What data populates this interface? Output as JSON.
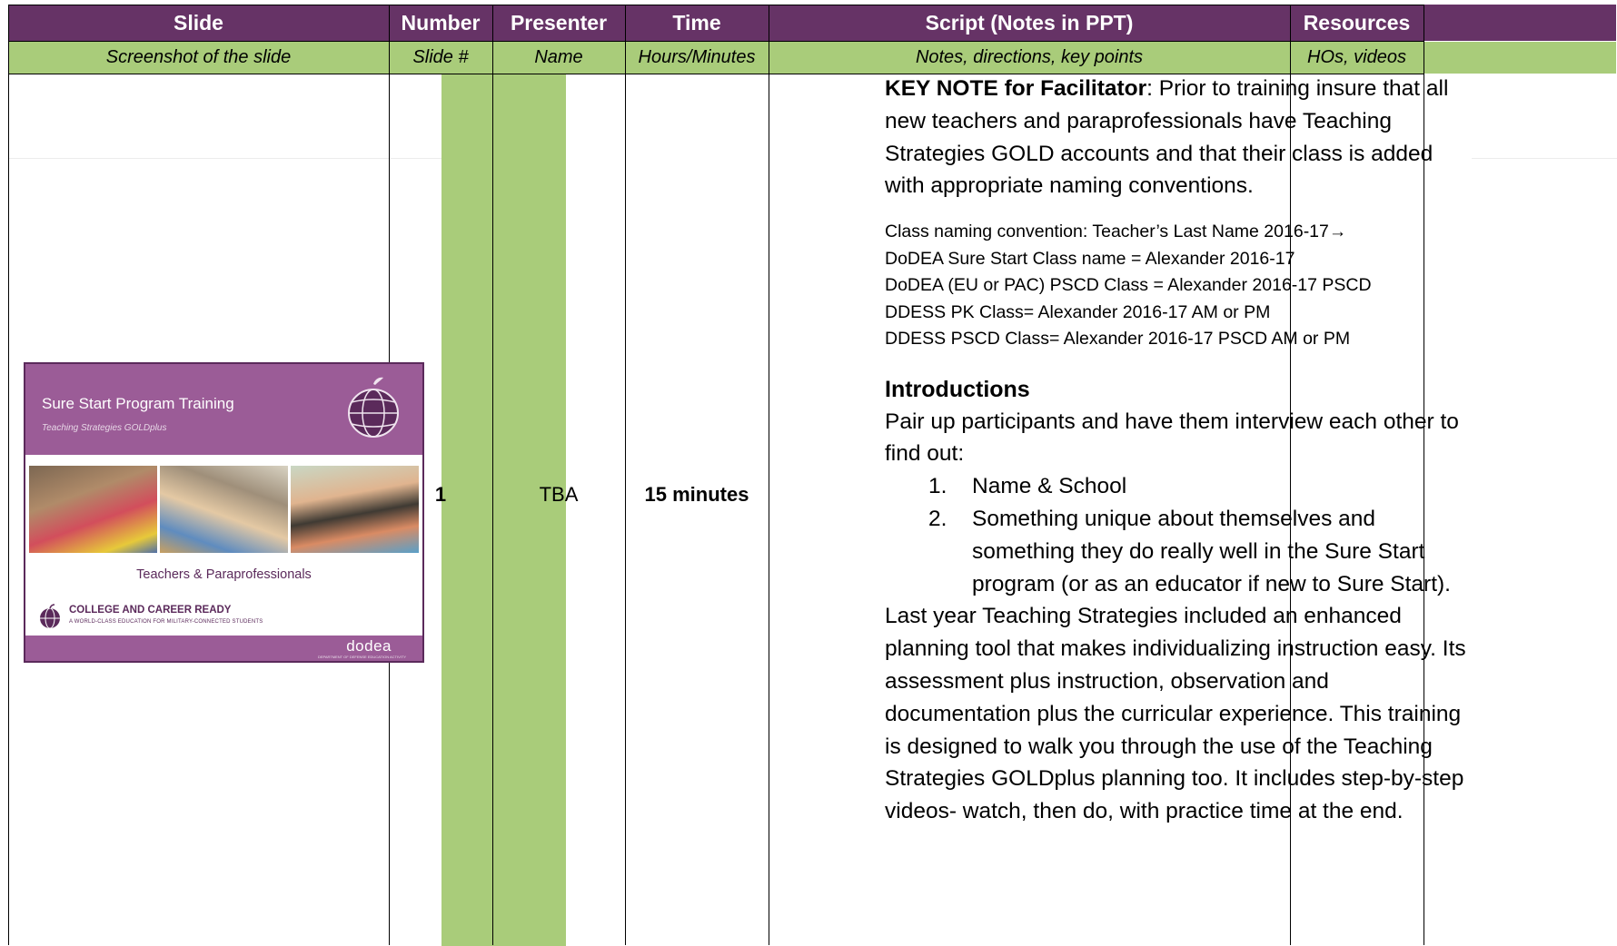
{
  "headers": {
    "slide": "Slide",
    "number": "Number",
    "presenter": "Presenter",
    "time": "Time",
    "script": "Script (Notes in PPT)",
    "resources": "Resources"
  },
  "subheaders": {
    "slide": "Screenshot of the slide",
    "number": "Slide #",
    "presenter": "Name",
    "time": "Hours/Minutes",
    "script": "Notes, directions, key points",
    "resources": "HOs, videos"
  },
  "row": {
    "number": "1",
    "presenter": "TBA",
    "time": "15 minutes",
    "slide_thumb": {
      "title": "Sure Start Program Training",
      "subtitle": "Teaching Strategies GOLDplus",
      "audience": "Teachers & Paraprofessionals",
      "ccr_title": "COLLEGE AND CAREER READY",
      "ccr_sub": "A WORLD-CLASS EDUCATION FOR MILITARY-CONNECTED STUDENTS",
      "brand": "dodea",
      "brand_sub": "DEPARTMENT OF DEFENSE EDUCATION ACTIVITY"
    },
    "script": {
      "key_note_label": "KEY NOTE for Facilitator",
      "key_note_text": ": Prior to training insure that all new teachers and paraprofessionals have Teaching Strategies GOLD accounts and that their class is added with appropriate naming conventions.",
      "naming_lines": [
        "Class naming convention: Teacher’s Last Name 2016-17→",
        "DoDEA Sure Start Class name = Alexander 2016-17",
        "DoDEA (EU or PAC) PSCD Class = Alexander 2016-17 PSCD",
        "DDESS PK Class= Alexander 2016-17 AM or PM",
        "DDESS PSCD Class= Alexander 2016-17 PSCD AM or PM"
      ],
      "intro_title": "Introductions",
      "intro_text": "Pair up participants and have them interview each other to find out:",
      "list": [
        {
          "num": "1.",
          "text": "Name & School"
        },
        {
          "num": "2.",
          "text": "Something unique about themselves and something they do really well in the Sure Start program (or as an educator if new to Sure Start)."
        }
      ],
      "closing": "Last year Teaching Strategies included an enhanced planning tool that makes individualizing instruction easy. Its assessment plus instruction, observation and documentation plus the curricular experience. This training is designed to walk you through the use of the Teaching Strategies GOLDplus planning too. It includes step-by-step videos- watch, then do, with practice time at the end."
    }
  },
  "colors": {
    "header_bg": "#663366",
    "subheader_bg": "#a9cc7a",
    "number_col_bg": "#a9cc7a",
    "thumb_purple": "#9b5c97"
  }
}
